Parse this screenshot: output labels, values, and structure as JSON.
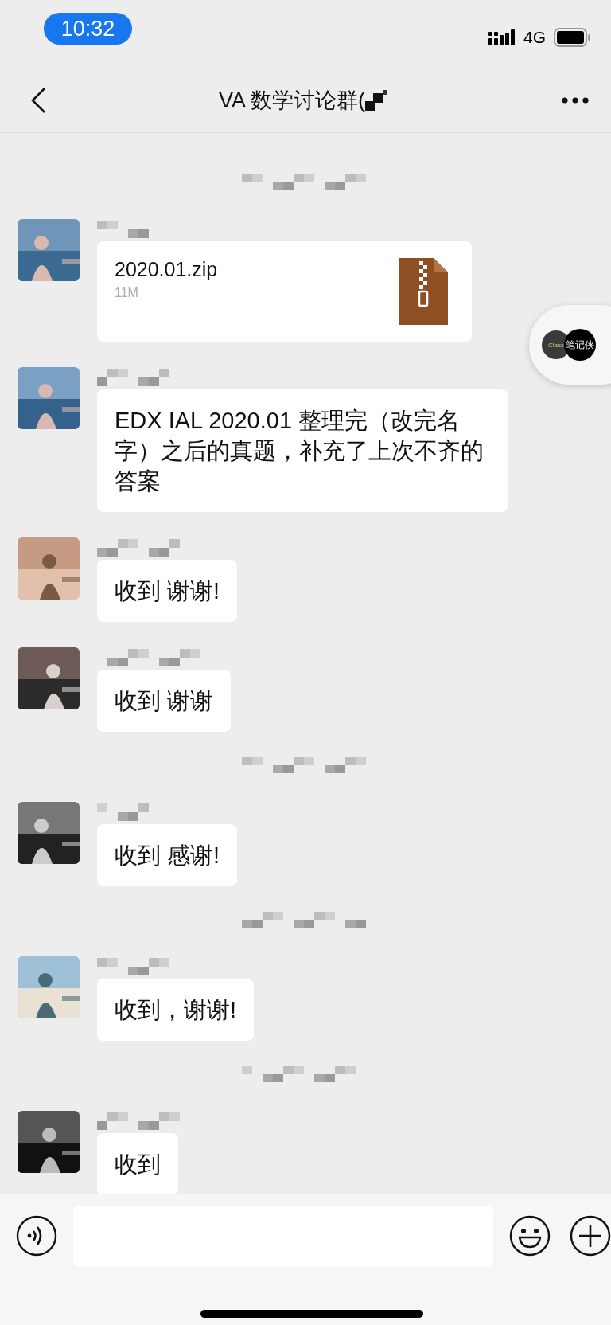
{
  "status_bar": {
    "time": "10:32",
    "network": "4G"
  },
  "nav": {
    "title": "VA 数学讨论群("
  },
  "floating_button": {
    "logo_left": "Class",
    "logo_right": "笔记侠"
  },
  "messages": [
    {
      "kind": "time"
    },
    {
      "kind": "file",
      "file_name": "2020.01.zip",
      "file_size": "11M"
    },
    {
      "kind": "text",
      "text": "EDX IAL 2020.01 整理完（改完名字）之后的真题，补充了上次不齐的答案"
    },
    {
      "kind": "text",
      "text": "收到 谢谢!"
    },
    {
      "kind": "text",
      "text": "收到 谢谢"
    },
    {
      "kind": "time"
    },
    {
      "kind": "text",
      "text": "收到 感谢!"
    },
    {
      "kind": "time"
    },
    {
      "kind": "text",
      "text": "收到，谢谢!"
    },
    {
      "kind": "time"
    },
    {
      "kind": "text",
      "text": "收到"
    }
  ]
}
